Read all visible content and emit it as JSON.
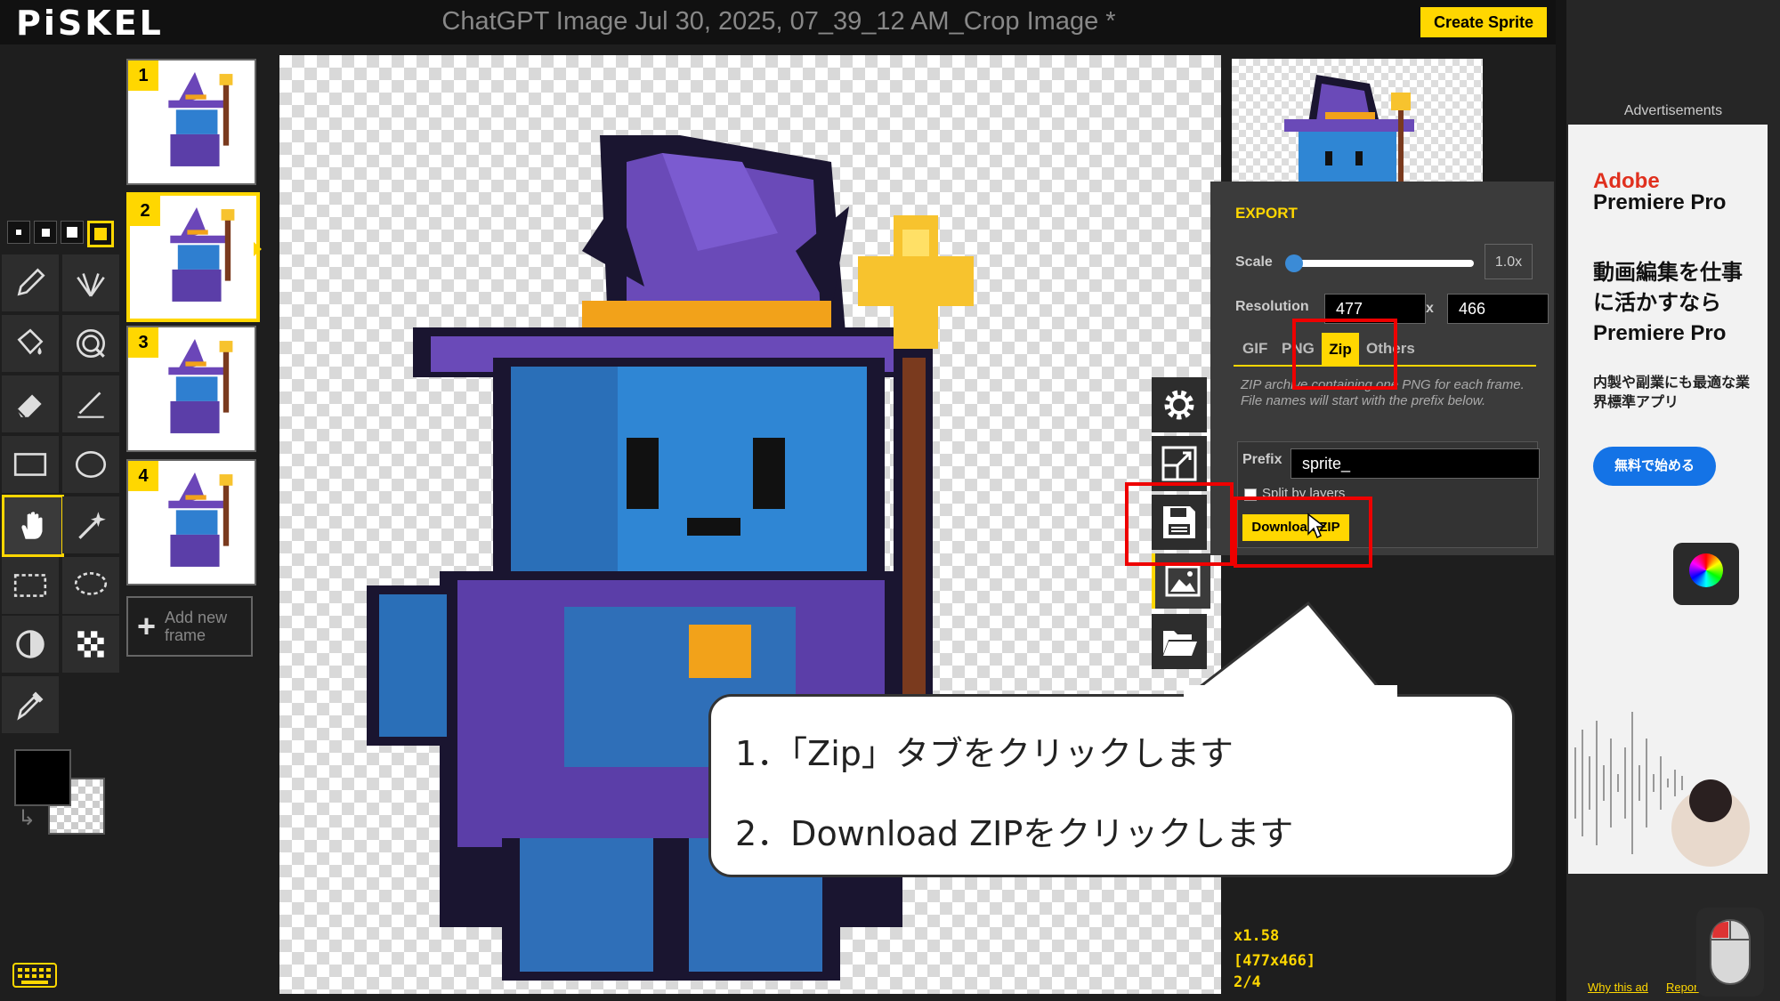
{
  "app": {
    "logo": "PiSKEL",
    "document_title": "ChatGPT Image Jul 30, 2025, 07_39_12 AM_Crop Image *",
    "create_button": "Create Sprite"
  },
  "tools": {
    "pen_sizes": [
      "1",
      "2",
      "3",
      "4"
    ],
    "active_pen_size": "4",
    "items": [
      {
        "name": "pen-tool",
        "icon": "pencil-icon"
      },
      {
        "name": "vertical-mirror-tool",
        "icon": "mirror-pen-icon"
      },
      {
        "name": "paint-bucket-tool",
        "icon": "bucket-icon"
      },
      {
        "name": "paint-same-color-tool",
        "icon": "spiral-icon"
      },
      {
        "name": "eraser-tool",
        "icon": "eraser-icon"
      },
      {
        "name": "stroke-tool",
        "icon": "line-icon"
      },
      {
        "name": "rectangle-tool",
        "icon": "rectangle-icon"
      },
      {
        "name": "circle-tool",
        "icon": "circle-icon"
      },
      {
        "name": "move-tool",
        "icon": "hand-icon"
      },
      {
        "name": "shape-select-tool",
        "icon": "magic-wand-icon"
      },
      {
        "name": "rectangle-select-tool",
        "icon": "rectangle-select-icon"
      },
      {
        "name": "lasso-select-tool",
        "icon": "lasso-icon"
      },
      {
        "name": "lighten-tool",
        "icon": "lighten-icon"
      },
      {
        "name": "dithering-tool",
        "icon": "checker-icon"
      },
      {
        "name": "color-picker-tool",
        "icon": "eyedropper-icon"
      }
    ],
    "primary_color": "#000000",
    "secondary_color": "transparent"
  },
  "frames": {
    "items": [
      {
        "number": "1"
      },
      {
        "number": "2"
      },
      {
        "number": "3"
      },
      {
        "number": "4"
      }
    ],
    "active": "2",
    "add_label": "Add new frame"
  },
  "settings_sidebar": {
    "items": [
      "settings-gear-icon",
      "resize-icon",
      "save-icon",
      "export-image-icon",
      "import-folder-icon"
    ]
  },
  "export": {
    "title": "EXPORT",
    "scale_label": "Scale",
    "scale_value": "1.0x",
    "resolution_label": "Resolution",
    "width": "477",
    "times": "x",
    "height": "466",
    "tabs": [
      "GIF",
      "PNG",
      "Zip",
      "Others"
    ],
    "active_tab": "Zip",
    "description": "ZIP archive containing one PNG for each frame. File names will start with the prefix below.",
    "prefix_label": "Prefix",
    "prefix_value": "sprite_",
    "split_label": "Split by layers",
    "download_button": "Download ZIP"
  },
  "callout": {
    "line1": "1．「Zip」タブをクリックします",
    "line2": "2．Download ZIPをクリックします"
  },
  "status": {
    "zoom": "x1.58",
    "size": "[477x466]",
    "frame": "2/4"
  },
  "ad": {
    "header": "Advertisements",
    "brand": "Adobe",
    "product": "Premiere Pro",
    "headline": "動画編集を仕事に活かすならPremiere Pro",
    "sub": "内製や副業にも最適な業界標準アプリ",
    "cta": "無料で始める",
    "why": "Why this ad",
    "report": "Report ad"
  },
  "colors": {
    "accent": "#ffd700",
    "highlight": "#ee0000",
    "ad_cta": "#1473e6"
  }
}
